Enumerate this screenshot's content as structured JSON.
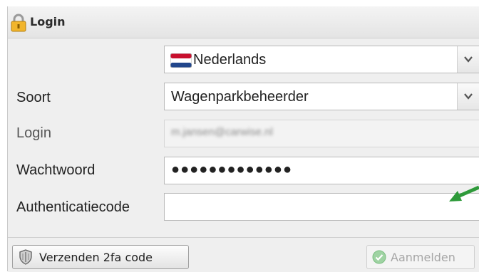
{
  "window": {
    "title": "Login"
  },
  "language": {
    "value": "Nederlands",
    "flag": "netherlands-flag-icon"
  },
  "soort": {
    "label": "Soort",
    "value": "Wagenparkbeheerder"
  },
  "login": {
    "label": "Login",
    "value": "m.jansen@carwise.nl"
  },
  "password": {
    "label": "Wachtwoord",
    "value": "●●●●●●●●●●●●●"
  },
  "authcode": {
    "label": "Authenticatiecode",
    "value": ""
  },
  "buttons": {
    "send_2fa": "Verzenden 2fa code",
    "login": "Aanmelden"
  },
  "colors": {
    "annotation_arrow": "#2e9a3a",
    "login_icon": "#4caf50"
  }
}
